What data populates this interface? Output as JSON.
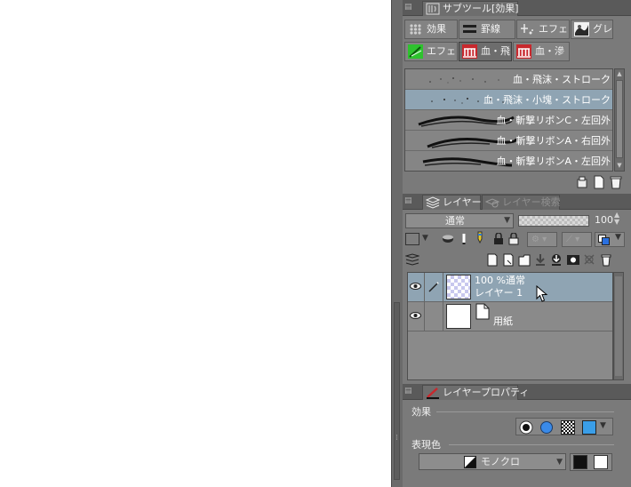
{
  "subtool_panel": {
    "title": "サブツール[効果]",
    "groups": [
      {
        "label": "効果",
        "icon": "effect-grid-icon",
        "selected": false
      },
      {
        "label": "罫線",
        "icon": "ruled-line-icon",
        "selected": false
      },
      {
        "label": "エフェク",
        "icon": "effect-sparkle-icon",
        "selected": false
      },
      {
        "label": "グレー",
        "icon": "gray-texture-icon",
        "selected": false
      },
      {
        "label": "エフェク",
        "icon": "green-effect-icon",
        "selected": false
      },
      {
        "label": "血・飛",
        "icon": "blood-splash-icon",
        "selected": true
      },
      {
        "label": "血・滲",
        "icon": "blood-bleed-icon",
        "selected": false
      }
    ],
    "brushes": [
      {
        "name": "血・飛沫・ストローク",
        "selected": false
      },
      {
        "name": "血・飛沫・小塊・ストローク",
        "selected": true
      },
      {
        "name": "血・斬撃リボンC・左回外",
        "selected": false
      },
      {
        "name": "血・斬撃リボンA・右回外",
        "selected": false
      },
      {
        "name": "血・斬撃リボンA・左回外",
        "selected": false
      }
    ],
    "footer_icons": [
      "copy-tool-icon",
      "new-page-icon",
      "trash-icon"
    ]
  },
  "layer_panel": {
    "tabs": [
      {
        "label": "レイヤー",
        "active": true
      },
      {
        "label": "レイヤー検索",
        "active": false
      }
    ],
    "blend_mode": "通常",
    "opacity": "100",
    "layers": [
      {
        "line1": "100 %通常",
        "line2": "レイヤー 1",
        "selected": true,
        "kind": "raster"
      },
      {
        "line1": "",
        "line2": "用紙",
        "selected": false,
        "kind": "paper"
      }
    ],
    "accent_color": "#8fa4b3"
  },
  "layer_property_panel": {
    "title": "レイヤープロパティ",
    "effect_label": "効果",
    "expression_color_label": "表現色",
    "expression_color_value": "モノクロ"
  },
  "colors": {
    "panel_bg": "#7a7a7a",
    "selection": "#8fa4b3",
    "blood_red": "#c8282d",
    "green": "#2ec22e"
  }
}
